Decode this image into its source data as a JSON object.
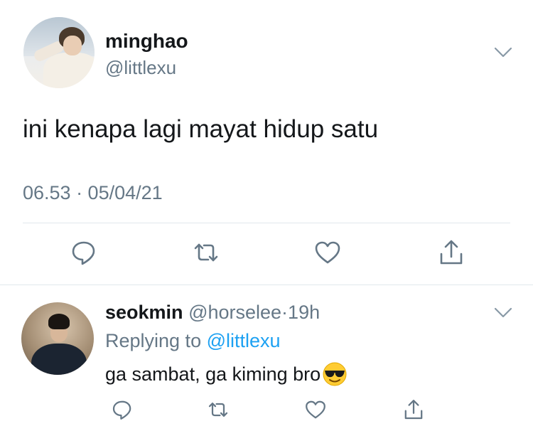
{
  "main_tweet": {
    "display_name": "minghao",
    "handle": "@littlexu",
    "text": "ini kenapa lagi mayat hidup satu",
    "timestamp": "06.53 · 05/04/21"
  },
  "reply": {
    "display_name": "seokmin",
    "handle": "@horselee",
    "separator": "·",
    "time_ago": "19h",
    "replying_prefix": "Replying to",
    "replying_handle": "@littlexu",
    "text": "ga sambat, ga kiming bro",
    "emoji": "smiling-face-with-sunglasses"
  },
  "icons": {
    "more": "chevron-down-icon",
    "reply": "reply-icon",
    "retweet": "retweet-icon",
    "like": "heart-icon",
    "share": "share-icon"
  },
  "colors": {
    "text_primary": "#14171a",
    "text_secondary": "#657786",
    "link": "#1da1f2",
    "divider": "#e1e8ed"
  }
}
